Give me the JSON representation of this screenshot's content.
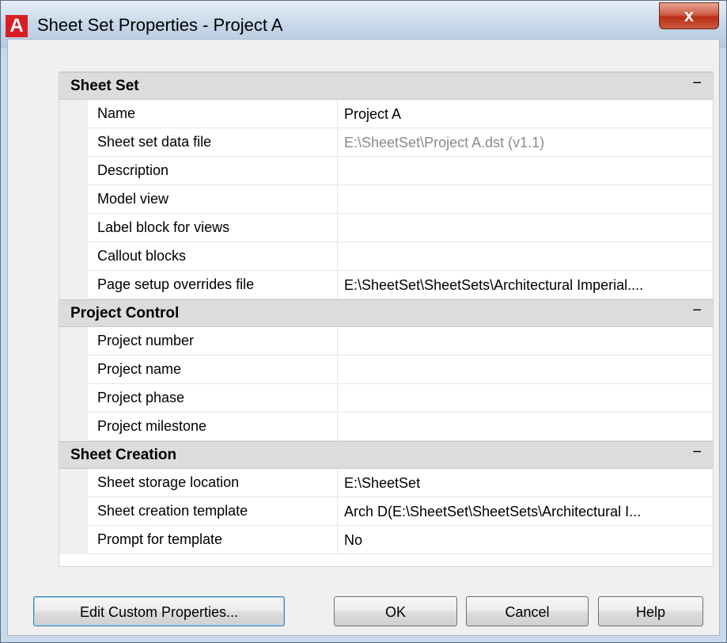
{
  "window": {
    "title": "Sheet Set Properties - Project A",
    "app_icon_letter": "A",
    "close_glyph": "x"
  },
  "sections": [
    {
      "title": "Sheet Set",
      "collapse_glyph": "−",
      "rows": [
        {
          "label": "Name",
          "value": "Project A",
          "dim": false
        },
        {
          "label": "Sheet set data file",
          "value": "E:\\SheetSet\\Project A.dst (v1.1)",
          "dim": true
        },
        {
          "label": "Description",
          "value": "",
          "dim": false
        },
        {
          "label": "Model view",
          "value": "",
          "dim": false
        },
        {
          "label": "Label block for views",
          "value": "",
          "dim": false
        },
        {
          "label": "Callout blocks",
          "value": "",
          "dim": false
        },
        {
          "label": "Page setup overrides file",
          "value": "E:\\SheetSet\\SheetSets\\Architectural Imperial....",
          "dim": false
        }
      ]
    },
    {
      "title": "Project Control",
      "collapse_glyph": "−",
      "rows": [
        {
          "label": "Project number",
          "value": "",
          "dim": false
        },
        {
          "label": "Project name",
          "value": "",
          "dim": false
        },
        {
          "label": "Project phase",
          "value": "",
          "dim": false
        },
        {
          "label": "Project milestone",
          "value": "",
          "dim": false
        }
      ]
    },
    {
      "title": "Sheet Creation",
      "collapse_glyph": "−",
      "rows": [
        {
          "label": "Sheet storage location",
          "value": "E:\\SheetSet",
          "dim": false
        },
        {
          "label": "Sheet creation template",
          "value": "Arch D(E:\\SheetSet\\SheetSets\\Architectural I...",
          "dim": false
        },
        {
          "label": "Prompt for template",
          "value": "No",
          "dim": false
        }
      ]
    }
  ],
  "buttons": {
    "edit_custom": "Edit Custom Properties...",
    "ok": "OK",
    "cancel": "Cancel",
    "help": "Help"
  },
  "colors": {
    "titlebar": "#c7d7e9",
    "close": "#c7432a",
    "section_header": "#dcdcdc",
    "dim_text": "#8a8a8a"
  }
}
